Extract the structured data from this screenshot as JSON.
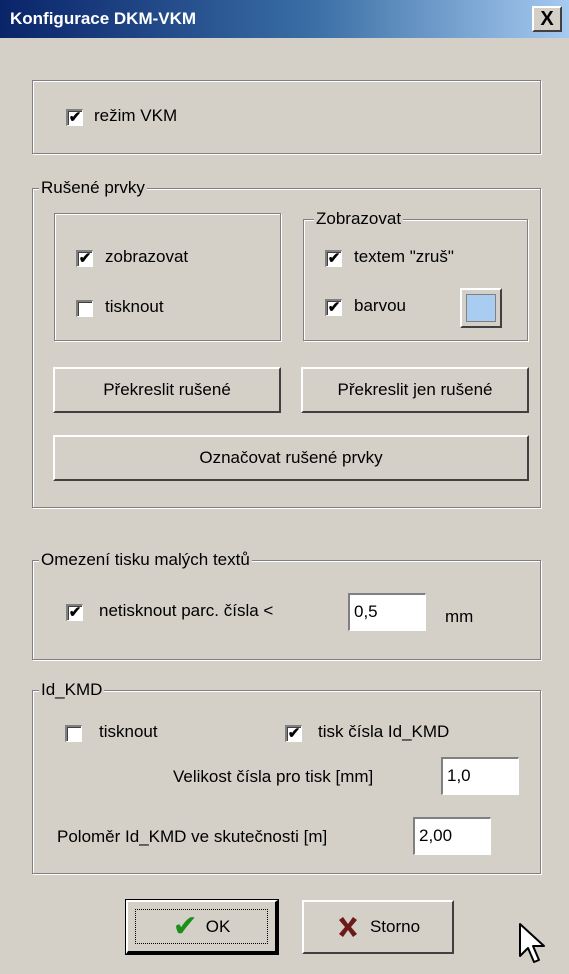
{
  "window": {
    "title": "Konfigurace DKM-VKM",
    "close_label": "X"
  },
  "vkm": {
    "checked": true,
    "label": "režim VKM"
  },
  "rusene": {
    "legend": "Rušené prvky",
    "zobrazovat": {
      "checked": true,
      "label": "zobrazovat"
    },
    "tisknout": {
      "checked": false,
      "label": "tisknout"
    },
    "zobrazovat_group": {
      "legend": "Zobrazovat",
      "textem": {
        "checked": true,
        "label": "textem \"zruš\""
      },
      "barvou": {
        "checked": true,
        "label": "barvou"
      },
      "color": "#a9cdf0"
    },
    "btn_prekreslit": "Překreslit rušené",
    "btn_prekreslit_jen": "Překreslit jen rušené",
    "btn_oznacovat": "Označovat rušené prvky"
  },
  "omezeni": {
    "legend": "Omezení tisku malých textů",
    "netisknout": {
      "checked": true,
      "label": "netisknout parc. čísla <"
    },
    "value": "0,5",
    "unit": "mm"
  },
  "idkmd": {
    "legend": "Id_KMD",
    "tisknout": {
      "checked": false,
      "label": "tisknout"
    },
    "tisk_cisla": {
      "checked": true,
      "label": "tisk čísla Id_KMD"
    },
    "velikost_label": "Velikost čísla pro tisk [mm]",
    "velikost_value": "1,0",
    "polomer_label": "Poloměr Id_KMD ve skutečnosti [m]",
    "polomer_value": "2,00"
  },
  "buttons": {
    "ok": "OK",
    "storno": "Storno"
  },
  "check_glyph": "✔"
}
